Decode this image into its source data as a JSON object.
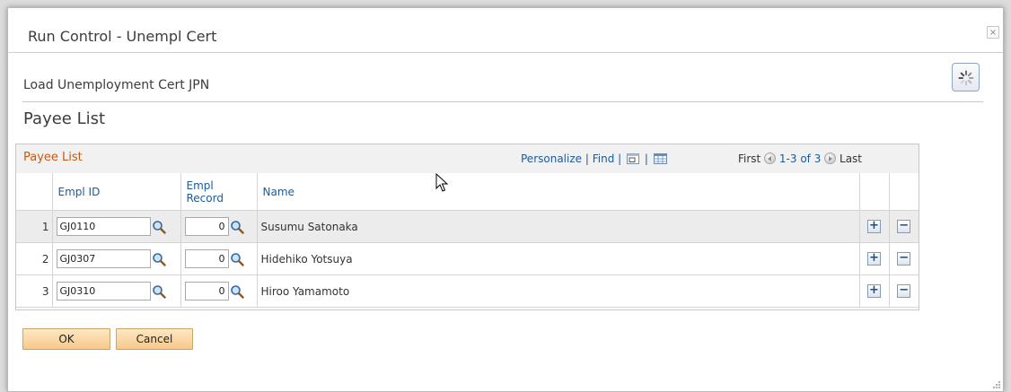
{
  "dialog": {
    "title": "Run Control - Unempl Cert",
    "close_label": "×"
  },
  "page": {
    "subtitle": "Load Unemployment Cert JPN",
    "heading": "Payee List"
  },
  "grid": {
    "title": "Payee List",
    "personalize": "Personalize",
    "find": "Find",
    "sep": "|",
    "first": "First",
    "range": "1-3 of 3",
    "last": "Last",
    "columns": {
      "empl_id": "Empl ID",
      "empl_record_line1": "Empl",
      "empl_record_line2": "Record",
      "name": "Name"
    },
    "rows": [
      {
        "num": "1",
        "empl_id": "GJ0110",
        "empl_record": "0",
        "name": "Susumu Satonaka"
      },
      {
        "num": "2",
        "empl_id": "GJ0307",
        "empl_record": "0",
        "name": "Hidehiko Yotsuya"
      },
      {
        "num": "3",
        "empl_id": "GJ0310",
        "empl_record": "0",
        "name": "Hiroo Yamamoto"
      }
    ],
    "add_row_label": "+",
    "delete_row_label": "−"
  },
  "buttons": {
    "ok": "OK",
    "cancel": "Cancel"
  },
  "colors": {
    "grid_title": "#c55a11",
    "link": "#1a5b9a",
    "button_fill": "#f7c98a"
  },
  "icons": [
    "close-icon",
    "processing-spinner-icon",
    "zoom-icon",
    "download-icon",
    "lookup-icon",
    "add-row-icon",
    "delete-row-icon",
    "mouse-pointer-icon"
  ]
}
